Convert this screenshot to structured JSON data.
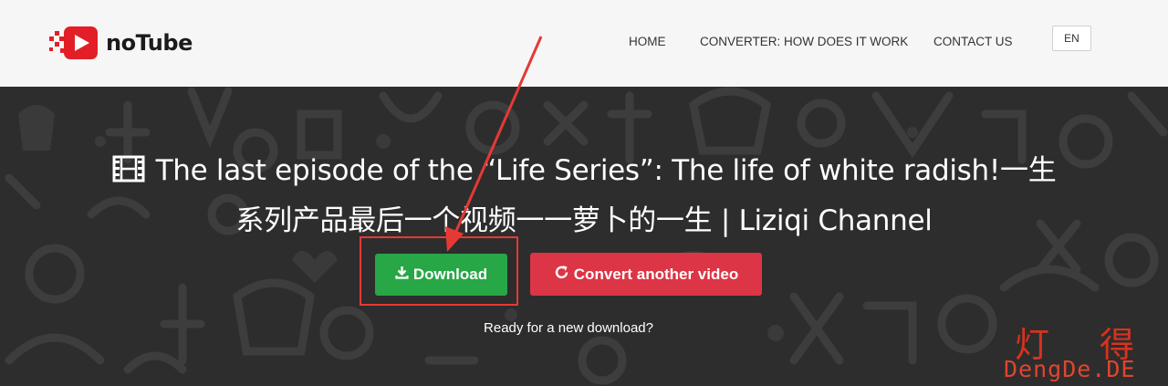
{
  "header": {
    "brand": "noTube",
    "nav": [
      {
        "label": "HOME"
      },
      {
        "label": "CONVERTER: HOW DOES IT WORK"
      },
      {
        "label": "CONTACT US"
      }
    ],
    "language": "EN"
  },
  "main": {
    "title_line1": "The last episode of the “Life Series”: The life of white radish!一生",
    "title_line2": "系列产品最后一个视频一一萝卜的一生 | Liziqi Channel",
    "download_label": "Download",
    "convert_label": "Convert another video",
    "ready_text": "Ready for a new download?"
  },
  "watermark": {
    "cn": "灯得",
    "en": "DengDe.DE"
  },
  "colors": {
    "download": "#27a745",
    "convert": "#dc3545",
    "annotation": "#e53935",
    "header_bg": "#f6f6f6",
    "hero_bg": "#2d2d2d"
  }
}
